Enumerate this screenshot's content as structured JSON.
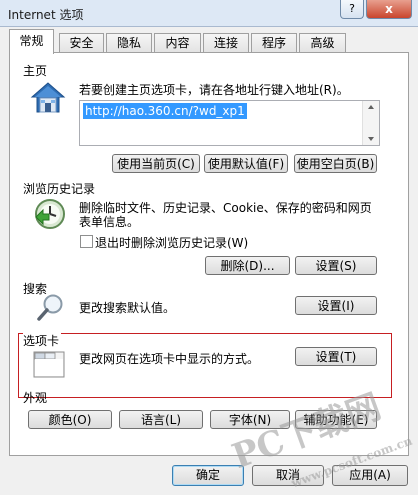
{
  "window": {
    "title": "Internet 选项",
    "help_label": "?",
    "close_label": "x"
  },
  "tabs": [
    "常规",
    "安全",
    "隐私",
    "内容",
    "连接",
    "程序",
    "高级"
  ],
  "homepage": {
    "section_label": "主页",
    "instruction": "若要创建主页选项卡，请在各地址行键入地址(R)。",
    "url": "http://hao.360.cn/?wd_xp1",
    "buttons": [
      "使用当前页(C)",
      "使用默认值(F)",
      "使用空白页(B)"
    ]
  },
  "history": {
    "section_label": "浏览历史记录",
    "description_line1": "删除临时文件、历史记录、Cookie、保存的密码和网页",
    "description_line2": "表单信息。",
    "checkbox_label": "退出时删除浏览历史记录(W)",
    "checkbox_checked": false,
    "delete_label": "删除(D)...",
    "settings_label": "设置(S)"
  },
  "search": {
    "section_label": "搜索",
    "description": "更改搜索默认值。",
    "settings_label": "设置(I)"
  },
  "tabs_section": {
    "section_label": "选项卡",
    "description": "更改网页在选项卡中显示的方式。",
    "settings_label": "设置(T)"
  },
  "appearance": {
    "section_label": "外观",
    "buttons": [
      "颜色(O)",
      "语言(L)",
      "字体(N)",
      "辅助功能(E)"
    ]
  },
  "dialog_buttons": {
    "ok": "确定",
    "cancel": "取消",
    "apply": "应用(A)"
  },
  "watermark": {
    "line1": "PC下载网",
    "line2": "www.pcsoft.com.cn"
  },
  "colors": {
    "highlight": "#c61f22",
    "selection": "#3399ff"
  }
}
